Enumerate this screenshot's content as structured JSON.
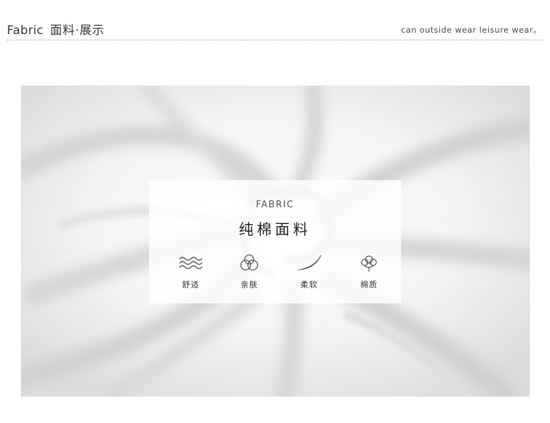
{
  "header": {
    "title_en": "Fabric",
    "title_zh": "面料·展示",
    "subtitle": "can outside wear leisure wear。"
  },
  "card": {
    "title_en": "FABRIC",
    "title_zh": "纯棉面料"
  },
  "features": [
    {
      "label": "舒适",
      "icon": "waves-icon"
    },
    {
      "label": "亲肤",
      "icon": "cloud-icon"
    },
    {
      "label": "柔软",
      "icon": "feather-icon"
    },
    {
      "label": "棉质",
      "icon": "cotton-flower-icon"
    }
  ],
  "colors": {
    "fabric": "#efefef",
    "text": "#333333",
    "divider": "#9a9a9a"
  }
}
